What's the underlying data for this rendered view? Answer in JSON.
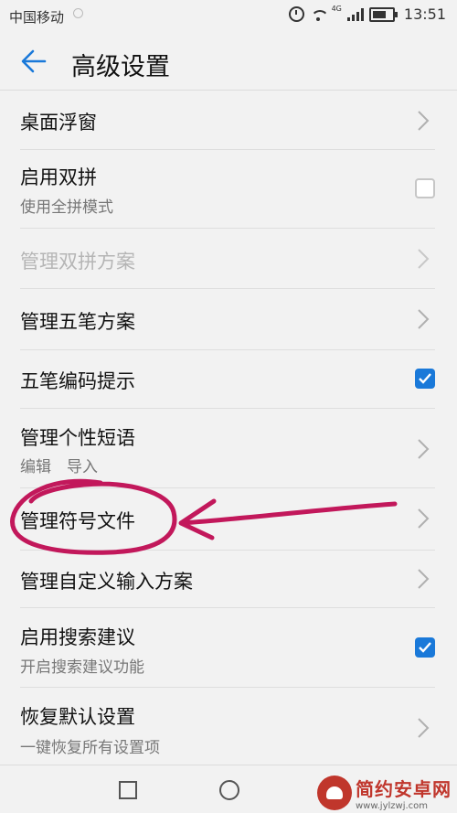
{
  "status_bar": {
    "carrier": "中国移动",
    "network_label": "4G",
    "time": "13:51"
  },
  "header": {
    "title": "高级设置",
    "back_icon": "arrow-left-icon"
  },
  "settings": [
    {
      "title": "桌面浮窗",
      "subtitle": "",
      "control": "chevron",
      "enabled": true
    },
    {
      "title": "启用双拼",
      "subtitle": "使用全拼模式",
      "control": "checkbox",
      "checked": false,
      "enabled": true
    },
    {
      "title": "管理双拼方案",
      "subtitle": "",
      "control": "chevron",
      "enabled": false
    },
    {
      "title": "管理五笔方案",
      "subtitle": "",
      "control": "chevron",
      "enabled": true
    },
    {
      "title": "五笔编码提示",
      "subtitle": "",
      "control": "checkbox",
      "checked": true,
      "enabled": true
    },
    {
      "title": "管理个性短语",
      "subtitle": "编辑　导入",
      "control": "chevron",
      "enabled": true
    },
    {
      "title": "管理符号文件",
      "subtitle": "",
      "control": "chevron",
      "enabled": true,
      "highlighted": true
    },
    {
      "title": "管理自定义输入方案",
      "subtitle": "",
      "control": "chevron",
      "enabled": true
    },
    {
      "title": "启用搜索建议",
      "subtitle": "开启搜索建议功能",
      "control": "checkbox",
      "checked": true,
      "enabled": true
    },
    {
      "title": "恢复默认设置",
      "subtitle": "一键恢复所有设置项",
      "control": "chevron",
      "enabled": true
    }
  ],
  "navbar": {
    "recent_icon": "square-icon",
    "home_icon": "circle-icon",
    "back_icon": "triangle-back-icon"
  },
  "watermark": {
    "name": "简约安卓网",
    "url": "www.jylzwj.com"
  },
  "colors": {
    "accent": "#1a79d9",
    "annotation": "#c2185b",
    "background": "#f2f2f2"
  }
}
